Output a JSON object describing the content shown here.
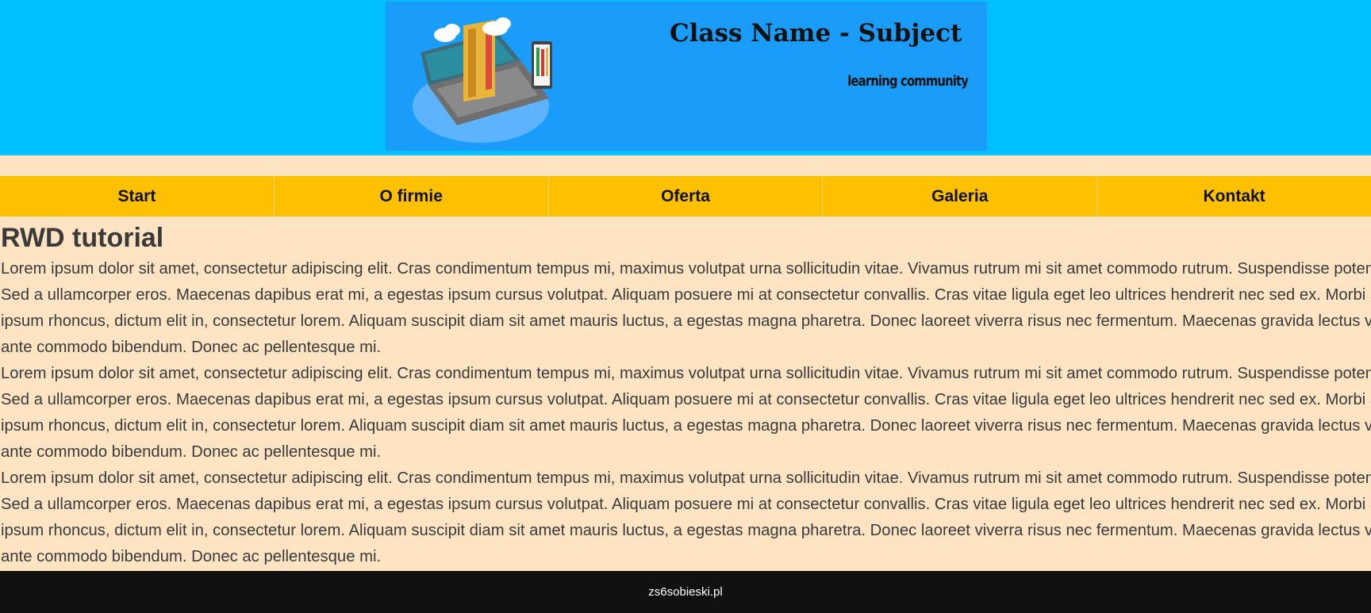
{
  "header": {
    "banner_title": "Class Name - Subject",
    "banner_subtitle": "learning community",
    "banner_icon": "laptop-books-illustration"
  },
  "nav": {
    "items": [
      {
        "label": "Start"
      },
      {
        "label": "O firmie"
      },
      {
        "label": "Oferta"
      },
      {
        "label": "Galeria"
      },
      {
        "label": "Kontakt"
      }
    ]
  },
  "main": {
    "heading": "RWD tutorial",
    "paragraphs": [
      "Lorem ipsum dolor sit amet, consectetur adipiscing elit. Cras condimentum tempus mi, maximus volutpat urna sollicitudin vitae. Vivamus rutrum mi sit amet commodo rutrum. Suspendisse potenti. Sed a ullamcorper eros. Maecenas dapibus erat mi, a egestas ipsum cursus volutpat. Aliquam posuere mi at consectetur convallis. Cras vitae ligula eget leo ultrices hendrerit nec sed ex. Morbi at ipsum rhoncus, dictum elit in, consectetur lorem. Aliquam suscipit diam sit amet mauris luctus, a egestas magna pharetra. Donec laoreet viverra risus nec fermentum. Maecenas gravida lectus vel ante commodo bibendum. Donec ac pellentesque mi.",
      "Lorem ipsum dolor sit amet, consectetur adipiscing elit. Cras condimentum tempus mi, maximus volutpat urna sollicitudin vitae. Vivamus rutrum mi sit amet commodo rutrum. Suspendisse potenti. Sed a ullamcorper eros. Maecenas dapibus erat mi, a egestas ipsum cursus volutpat. Aliquam posuere mi at consectetur convallis. Cras vitae ligula eget leo ultrices hendrerit nec sed ex. Morbi at ipsum rhoncus, dictum elit in, consectetur lorem. Aliquam suscipit diam sit amet mauris luctus, a egestas magna pharetra. Donec laoreet viverra risus nec fermentum. Maecenas gravida lectus vel ante commodo bibendum. Donec ac pellentesque mi.",
      "Lorem ipsum dolor sit amet, consectetur adipiscing elit. Cras condimentum tempus mi, maximus volutpat urna sollicitudin vitae. Vivamus rutrum mi sit amet commodo rutrum. Suspendisse potenti. Sed a ullamcorper eros. Maecenas dapibus erat mi, a egestas ipsum cursus volutpat. Aliquam posuere mi at consectetur convallis. Cras vitae ligula eget leo ultrices hendrerit nec sed ex. Morbi at ipsum rhoncus, dictum elit in, consectetur lorem. Aliquam suscipit diam sit amet mauris luctus, a egestas magna pharetra. Donec laoreet viverra risus nec fermentum. Maecenas gravida lectus vel ante commodo bibendum. Donec ac pellentesque mi."
    ]
  },
  "footer": {
    "text": "zs6sobieski.pl"
  },
  "colors": {
    "header_bg": "#00bfff",
    "banner_bg": "#1a9dfa",
    "page_bg": "#ffe4c4",
    "nav_bg": "#ffc000",
    "footer_bg": "#111111"
  }
}
